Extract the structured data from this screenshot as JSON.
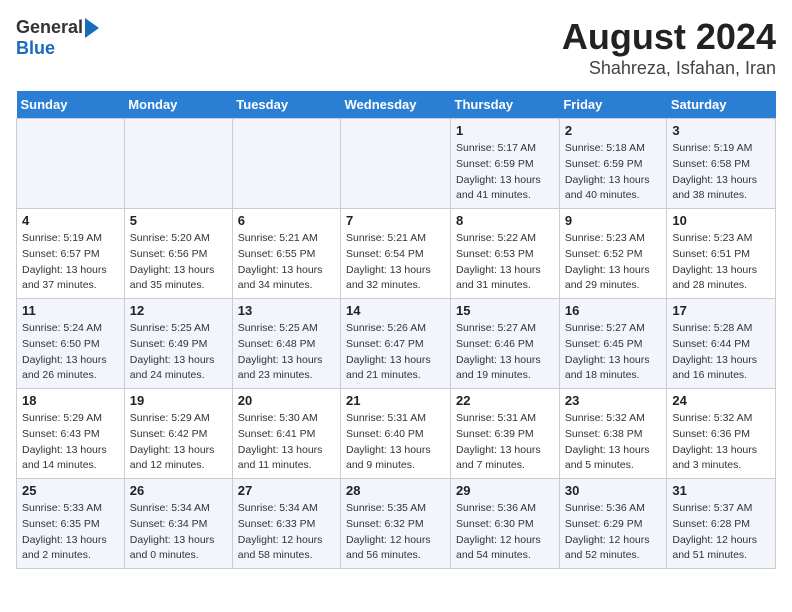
{
  "logo": {
    "general": "General",
    "blue": "Blue"
  },
  "title": "August 2024",
  "subtitle": "Shahreza, Isfahan, Iran",
  "headers": [
    "Sunday",
    "Monday",
    "Tuesday",
    "Wednesday",
    "Thursday",
    "Friday",
    "Saturday"
  ],
  "weeks": [
    [
      {
        "day": "",
        "detail": ""
      },
      {
        "day": "",
        "detail": ""
      },
      {
        "day": "",
        "detail": ""
      },
      {
        "day": "",
        "detail": ""
      },
      {
        "day": "1",
        "detail": "Sunrise: 5:17 AM\nSunset: 6:59 PM\nDaylight: 13 hours\nand 41 minutes."
      },
      {
        "day": "2",
        "detail": "Sunrise: 5:18 AM\nSunset: 6:59 PM\nDaylight: 13 hours\nand 40 minutes."
      },
      {
        "day": "3",
        "detail": "Sunrise: 5:19 AM\nSunset: 6:58 PM\nDaylight: 13 hours\nand 38 minutes."
      }
    ],
    [
      {
        "day": "4",
        "detail": "Sunrise: 5:19 AM\nSunset: 6:57 PM\nDaylight: 13 hours\nand 37 minutes."
      },
      {
        "day": "5",
        "detail": "Sunrise: 5:20 AM\nSunset: 6:56 PM\nDaylight: 13 hours\nand 35 minutes."
      },
      {
        "day": "6",
        "detail": "Sunrise: 5:21 AM\nSunset: 6:55 PM\nDaylight: 13 hours\nand 34 minutes."
      },
      {
        "day": "7",
        "detail": "Sunrise: 5:21 AM\nSunset: 6:54 PM\nDaylight: 13 hours\nand 32 minutes."
      },
      {
        "day": "8",
        "detail": "Sunrise: 5:22 AM\nSunset: 6:53 PM\nDaylight: 13 hours\nand 31 minutes."
      },
      {
        "day": "9",
        "detail": "Sunrise: 5:23 AM\nSunset: 6:52 PM\nDaylight: 13 hours\nand 29 minutes."
      },
      {
        "day": "10",
        "detail": "Sunrise: 5:23 AM\nSunset: 6:51 PM\nDaylight: 13 hours\nand 28 minutes."
      }
    ],
    [
      {
        "day": "11",
        "detail": "Sunrise: 5:24 AM\nSunset: 6:50 PM\nDaylight: 13 hours\nand 26 minutes."
      },
      {
        "day": "12",
        "detail": "Sunrise: 5:25 AM\nSunset: 6:49 PM\nDaylight: 13 hours\nand 24 minutes."
      },
      {
        "day": "13",
        "detail": "Sunrise: 5:25 AM\nSunset: 6:48 PM\nDaylight: 13 hours\nand 23 minutes."
      },
      {
        "day": "14",
        "detail": "Sunrise: 5:26 AM\nSunset: 6:47 PM\nDaylight: 13 hours\nand 21 minutes."
      },
      {
        "day": "15",
        "detail": "Sunrise: 5:27 AM\nSunset: 6:46 PM\nDaylight: 13 hours\nand 19 minutes."
      },
      {
        "day": "16",
        "detail": "Sunrise: 5:27 AM\nSunset: 6:45 PM\nDaylight: 13 hours\nand 18 minutes."
      },
      {
        "day": "17",
        "detail": "Sunrise: 5:28 AM\nSunset: 6:44 PM\nDaylight: 13 hours\nand 16 minutes."
      }
    ],
    [
      {
        "day": "18",
        "detail": "Sunrise: 5:29 AM\nSunset: 6:43 PM\nDaylight: 13 hours\nand 14 minutes."
      },
      {
        "day": "19",
        "detail": "Sunrise: 5:29 AM\nSunset: 6:42 PM\nDaylight: 13 hours\nand 12 minutes."
      },
      {
        "day": "20",
        "detail": "Sunrise: 5:30 AM\nSunset: 6:41 PM\nDaylight: 13 hours\nand 11 minutes."
      },
      {
        "day": "21",
        "detail": "Sunrise: 5:31 AM\nSunset: 6:40 PM\nDaylight: 13 hours\nand 9 minutes."
      },
      {
        "day": "22",
        "detail": "Sunrise: 5:31 AM\nSunset: 6:39 PM\nDaylight: 13 hours\nand 7 minutes."
      },
      {
        "day": "23",
        "detail": "Sunrise: 5:32 AM\nSunset: 6:38 PM\nDaylight: 13 hours\nand 5 minutes."
      },
      {
        "day": "24",
        "detail": "Sunrise: 5:32 AM\nSunset: 6:36 PM\nDaylight: 13 hours\nand 3 minutes."
      }
    ],
    [
      {
        "day": "25",
        "detail": "Sunrise: 5:33 AM\nSunset: 6:35 PM\nDaylight: 13 hours\nand 2 minutes."
      },
      {
        "day": "26",
        "detail": "Sunrise: 5:34 AM\nSunset: 6:34 PM\nDaylight: 13 hours\nand 0 minutes."
      },
      {
        "day": "27",
        "detail": "Sunrise: 5:34 AM\nSunset: 6:33 PM\nDaylight: 12 hours\nand 58 minutes."
      },
      {
        "day": "28",
        "detail": "Sunrise: 5:35 AM\nSunset: 6:32 PM\nDaylight: 12 hours\nand 56 minutes."
      },
      {
        "day": "29",
        "detail": "Sunrise: 5:36 AM\nSunset: 6:30 PM\nDaylight: 12 hours\nand 54 minutes."
      },
      {
        "day": "30",
        "detail": "Sunrise: 5:36 AM\nSunset: 6:29 PM\nDaylight: 12 hours\nand 52 minutes."
      },
      {
        "day": "31",
        "detail": "Sunrise: 5:37 AM\nSunset: 6:28 PM\nDaylight: 12 hours\nand 51 minutes."
      }
    ]
  ]
}
